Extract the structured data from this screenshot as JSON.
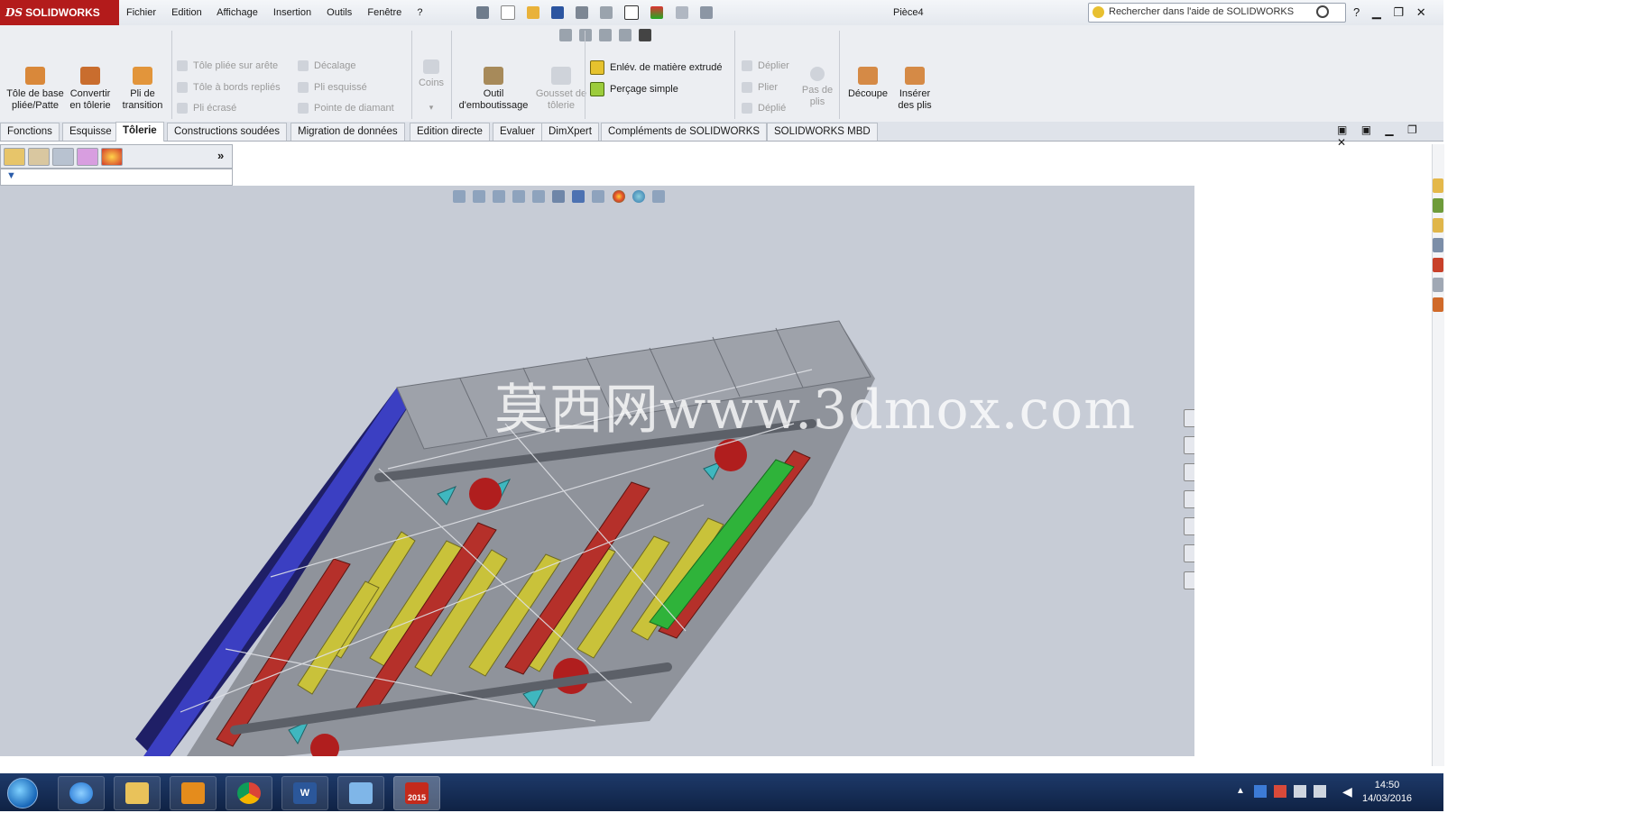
{
  "app": {
    "brand": "SOLIDWORKS",
    "brand_prefix": "DS",
    "document_title": "Pièce4"
  },
  "menu": [
    "Fichier",
    "Edition",
    "Affichage",
    "Insertion",
    "Outils",
    "Fenêtre",
    "?"
  ],
  "search": {
    "placeholder": "Rechercher dans l'aide de SOLIDWORKS"
  },
  "commands": {
    "base_flange": "Tôle de base pliée/Patte",
    "convert": "Convertir en tôlerie",
    "lofted_bend": "Pli de transition",
    "edge_flange": "Tôle pliée sur arête",
    "miter_flange": "Tôle à bords repliés",
    "hem": "Pli écrasé",
    "jog": "Décalage",
    "sketched_bend": "Pli esquissé",
    "cross_break": "Pointe de diamant",
    "corners": "Coins",
    "forming_tool": "Outil d'emboutissage",
    "gusset": "Gousset de tôlerie",
    "extruded_cut": "Enlév. de matière extrudé",
    "simple_hole": "Perçage simple",
    "unfold": "Déplier",
    "fold": "Plier",
    "flatten": "Déplié",
    "no_bends": "Pas de plis",
    "rip": "Découpe",
    "insert_bends": "Insérer des plis"
  },
  "tabs": [
    "Fonctions",
    "Esquisse",
    "Tôlerie",
    "Constructions soudées",
    "Migration de données",
    "Edition directe",
    "Evaluer",
    "DimXpert",
    "Compléments de SOLIDWORKS",
    "SOLIDWORKS MBD"
  ],
  "active_tab": "Tôlerie",
  "viewport": {
    "watermark": "莫西网www.3dmox.com"
  },
  "taskbar": {
    "active_app_label": "2015"
  },
  "clock": {
    "time": "14:50",
    "date": "14/03/2016"
  },
  "colors": {
    "brand_red": "#b31b1b",
    "viewport_bg": "#c7ccd6",
    "taskbar": "#1e3a6a"
  },
  "icons": [
    "save-icon",
    "open-icon",
    "new-document-icon",
    "print-icon",
    "undo-icon",
    "select-cursor-icon",
    "rebuild-icon",
    "options-icon",
    "help-icon",
    "search-icon",
    "minimize-icon",
    "restore-icon",
    "close-icon"
  ]
}
